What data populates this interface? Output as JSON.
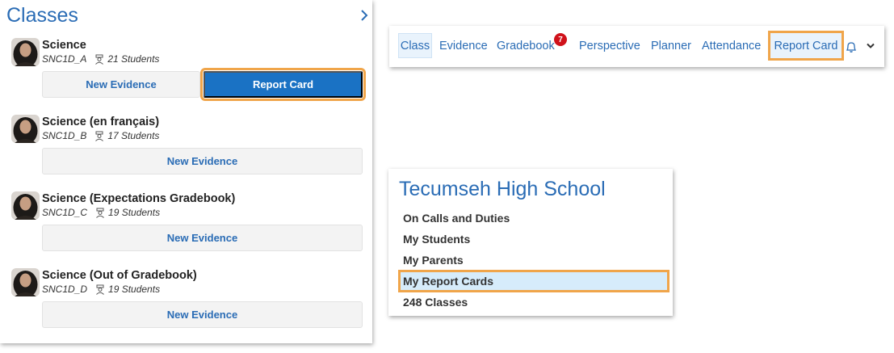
{
  "classes_panel": {
    "title": "Classes",
    "classes": [
      {
        "name": "Science",
        "code": "SNC1D_A",
        "students": "21 Students",
        "evidence_label": "New Evidence",
        "report_label": "Report Card"
      },
      {
        "name": "Science (en français)",
        "code": "SNC1D_B",
        "students": "17 Students",
        "evidence_label": "New Evidence"
      },
      {
        "name": "Science (Expectations Gradebook)",
        "code": "SNC1D_C",
        "students": "19 Students",
        "evidence_label": "New Evidence"
      },
      {
        "name": "Science (Out of Gradebook)",
        "code": "SNC1D_D",
        "students": "19 Students",
        "evidence_label": "New Evidence"
      }
    ]
  },
  "navbar": {
    "items": [
      "Class",
      "Evidence",
      "Gradebook",
      "Perspective",
      "Planner",
      "Attendance",
      "Report Card"
    ],
    "gradebook_badge": "7",
    "icons": [
      "bell-icon",
      "chevron-down-icon"
    ]
  },
  "school_panel": {
    "title": "Tecumseh High School",
    "items": [
      "On Calls and Duties",
      "My Students",
      "My Parents",
      "My Report Cards",
      "248 Classes"
    ]
  },
  "colors": {
    "accent": "#2a6cb5",
    "primary_button": "#1a72c4",
    "highlight_outline": "#f0a54a",
    "badge": "#d0121b"
  }
}
